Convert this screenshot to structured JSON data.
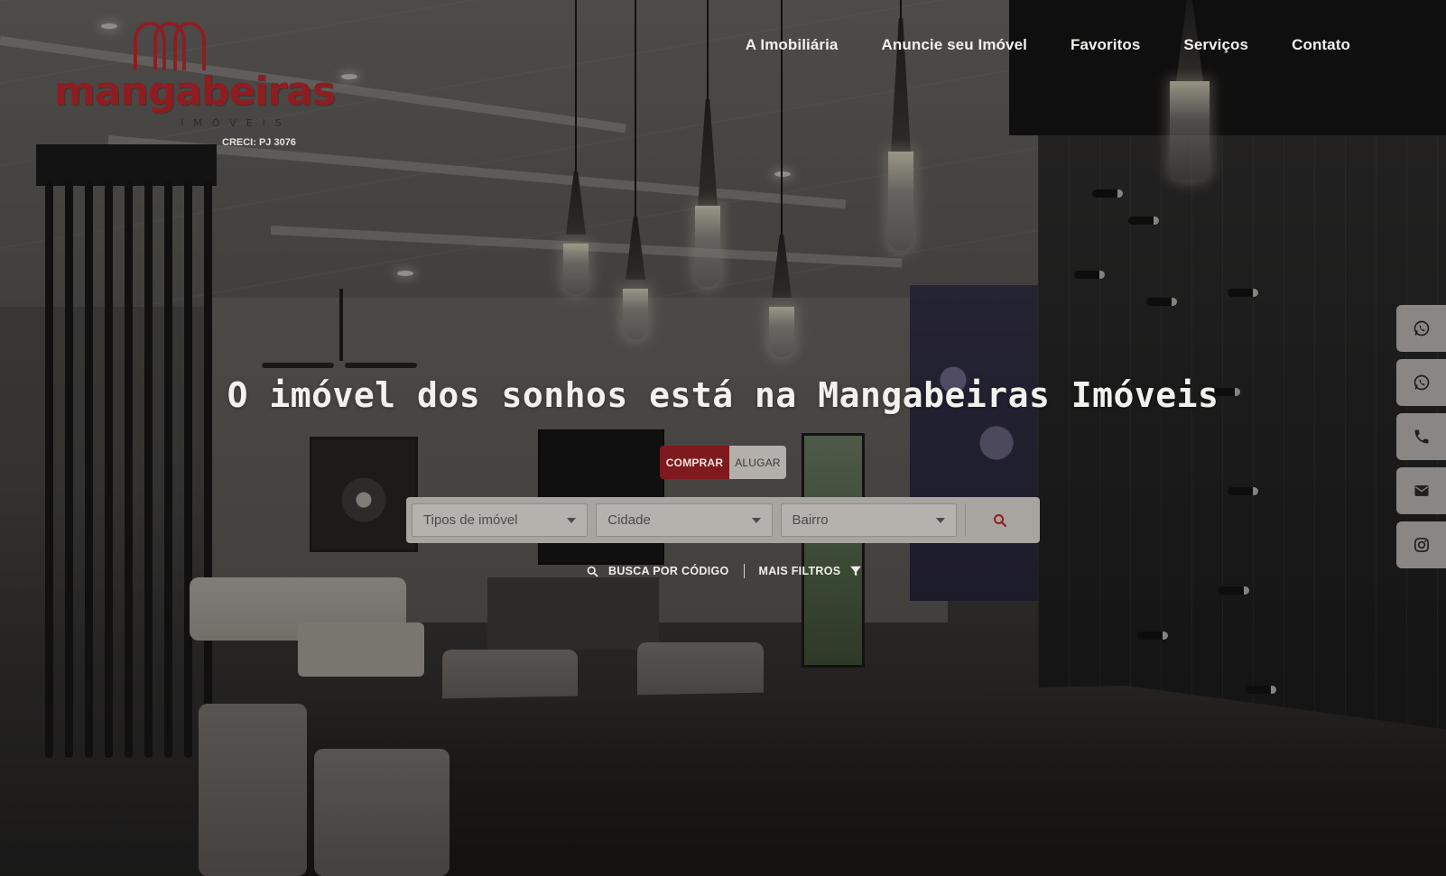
{
  "brand": {
    "name": "mangabeiras",
    "subtitle": "IMÓVEIS",
    "creci": "CRECI: PJ 3076",
    "accent_color": "#8e1d22"
  },
  "nav": {
    "items": [
      {
        "label": "A Imobiliária"
      },
      {
        "label": "Anuncie seu Imóvel"
      },
      {
        "label": "Favoritos"
      },
      {
        "label": "Serviços"
      },
      {
        "label": "Contato"
      }
    ]
  },
  "hero": {
    "headline": "O imóvel dos sonhos está na Mangabeiras Imóveis"
  },
  "search": {
    "modes": [
      {
        "label": "COMPRAR",
        "active": true
      },
      {
        "label": "ALUGAR",
        "active": false
      }
    ],
    "fields": [
      {
        "value": "Tipos de imóvel"
      },
      {
        "value": "Cidade"
      },
      {
        "value": "Bairro"
      }
    ],
    "search_icon": "search-icon"
  },
  "links": {
    "by_code": "BUSCA POR CÓDIGO",
    "more_filters": "MAIS FILTROS"
  },
  "contact_bar": {
    "icons": [
      "whatsapp-icon",
      "whatsapp-icon",
      "phone-icon",
      "mail-icon",
      "instagram-icon"
    ],
    "background_color": "#8a8683"
  }
}
